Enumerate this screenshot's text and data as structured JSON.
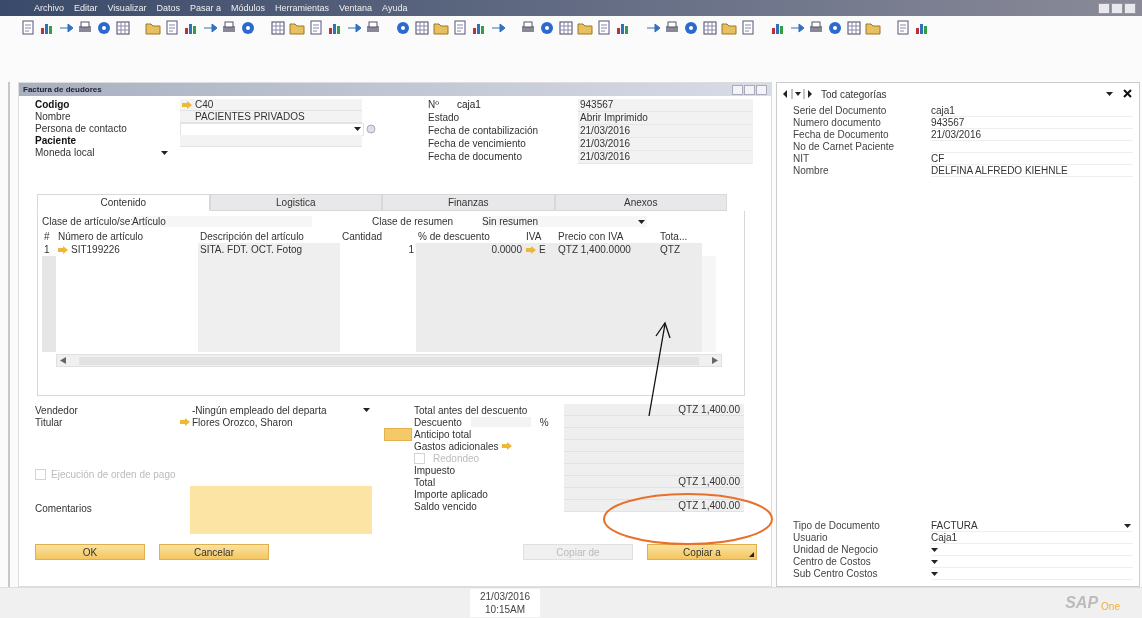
{
  "menu_bar": {
    "items": [
      "Archivo",
      "Editar",
      "Visualizar",
      "Datos",
      "Pasar a",
      "Módulos",
      "Herramientas",
      "Ventana",
      "Ayuda"
    ]
  },
  "document": {
    "title": "Factura de deudores",
    "header_left": [
      {
        "label": "Codigo",
        "bold": true,
        "kind": "field",
        "link": true,
        "value": "C40"
      },
      {
        "label": "Nombre",
        "bold": false,
        "kind": "field",
        "link": false,
        "value": "PACIENTES PRIVADOS"
      },
      {
        "label": "Persona de contacto",
        "bold": false,
        "kind": "dropdown",
        "link": false
      },
      {
        "label": "Paciente",
        "bold": true,
        "kind": "field",
        "link": false
      },
      {
        "label": "Moneda local",
        "bold": false,
        "kind": "label_dropdown"
      }
    ],
    "header_right": [
      {
        "label": "Nº",
        "series": "caja1",
        "value": "943567"
      },
      {
        "label": "Estado",
        "value": "Abrir  Imprimido"
      },
      {
        "label": "Fecha de contabilización",
        "value": "21/03/2016"
      },
      {
        "label": "Fecha de vencimiento",
        "value": "21/03/2016"
      },
      {
        "label": "Fecha de documento",
        "value": "21/03/2016"
      }
    ],
    "tabs": [
      {
        "label": "Contenido",
        "selected": true
      },
      {
        "label": "Logistica",
        "selected": false
      },
      {
        "label": "Finanzas",
        "selected": false
      },
      {
        "label": "Anexos",
        "selected": false
      }
    ],
    "line_type": {
      "label": "Clase de artículo/se:",
      "value": "Artículo"
    },
    "summary_type": {
      "label": "Clase de resumen",
      "value": "Sin resumen"
    },
    "table": {
      "columns": [
        "#",
        "Número de artículo",
        "Descripción del artículo",
        "Cantidad",
        "% de descuento",
        "IVA",
        "Precio con IVA",
        "Tota..."
      ],
      "rows": [
        {
          "cells": [
            {
              "text": "1",
              "link": false
            },
            {
              "text": "SIT199226",
              "link": true
            },
            {
              "text": "SITA. FDT. OCT. Fotog",
              "link": false
            },
            {
              "text": "1",
              "link": false
            },
            {
              "text": "0.0000",
              "link": false
            },
            {
              "text": "E",
              "link": true
            },
            {
              "text": "QTZ 1,400.0000",
              "link": false
            },
            {
              "text": "QTZ",
              "link": false
            }
          ]
        }
      ]
    },
    "seller": {
      "label": "Vendedor",
      "value": "-Ningún empleado del departa",
      "kind": "dropdown"
    },
    "owner": {
      "label": "Titular",
      "value": "Flores Orozco, Sharon",
      "kind": "link"
    },
    "payment_order": {
      "label": "Ejecución de orden de pago",
      "checked": false,
      "disabled": true
    },
    "comments": {
      "label": "Comentarios"
    },
    "totals": [
      {
        "kind": "amount",
        "label": "Total antes del descuento",
        "value": "QTZ 1,400.00"
      },
      {
        "kind": "percent",
        "label": "Descuento",
        "unit": "%"
      },
      {
        "kind": "button",
        "label": "Anticipo total"
      },
      {
        "kind": "link",
        "label": "Gastos adicionales"
      },
      {
        "kind": "checkbox",
        "label": "Redondeo",
        "checked": false,
        "disabled": true
      },
      {
        "kind": "amount",
        "label": "Impuesto"
      },
      {
        "kind": "amount",
        "label": "Total",
        "value": "QTZ 1,400.00"
      },
      {
        "kind": "amount",
        "label": "Importe aplicado"
      },
      {
        "kind": "amount",
        "label": "Saldo vencido",
        "value": "QTZ 1,400.00"
      }
    ],
    "actions_left": [
      {
        "label": "OK",
        "disabled": false,
        "menu": false
      },
      {
        "label": "Cancelar",
        "disabled": false,
        "menu": false
      }
    ],
    "actions_right": [
      {
        "label": "Copiar de",
        "disabled": true,
        "menu": false
      },
      {
        "label": "Copiar a",
        "disabled": false,
        "menu": true
      }
    ]
  },
  "side_panel": {
    "navigator": {
      "label": "Tod categorías"
    },
    "fields_top": [
      {
        "label": "Serie del Documento",
        "value": "caja1",
        "dropdown": false
      },
      {
        "label": "Numero documento",
        "value": "943567",
        "dropdown": false
      },
      {
        "label": "Fecha de Documento",
        "value": "21/03/2016",
        "dropdown": false
      },
      {
        "label": "No de Carnet Paciente",
        "dropdown": false
      },
      {
        "label": "NIT",
        "value": "CF",
        "dropdown": false
      },
      {
        "label": "Nombre",
        "value": "DELFINA ALFREDO KIEHNLE",
        "dropdown": false
      }
    ],
    "fields_bottom": [
      {
        "label": "Tipo de Documento",
        "value": "FACTURA",
        "dropdown": true
      },
      {
        "label": "Usuario",
        "value": "Caja1",
        "dropdown": false
      },
      {
        "label": "Unidad de Negocio",
        "dropdown": true
      },
      {
        "label": "Centro de Costos",
        "dropdown": true
      },
      {
        "label": "Sub Centro Costos",
        "dropdown": true
      }
    ]
  },
  "status_bar": {
    "date": "21/03/2016",
    "time": "10:15AM"
  },
  "logo": {
    "main": "SAP",
    "sub": "One"
  },
  "annotations": [
    {
      "kind": "arrow"
    },
    {
      "kind": "ellipse"
    }
  ]
}
